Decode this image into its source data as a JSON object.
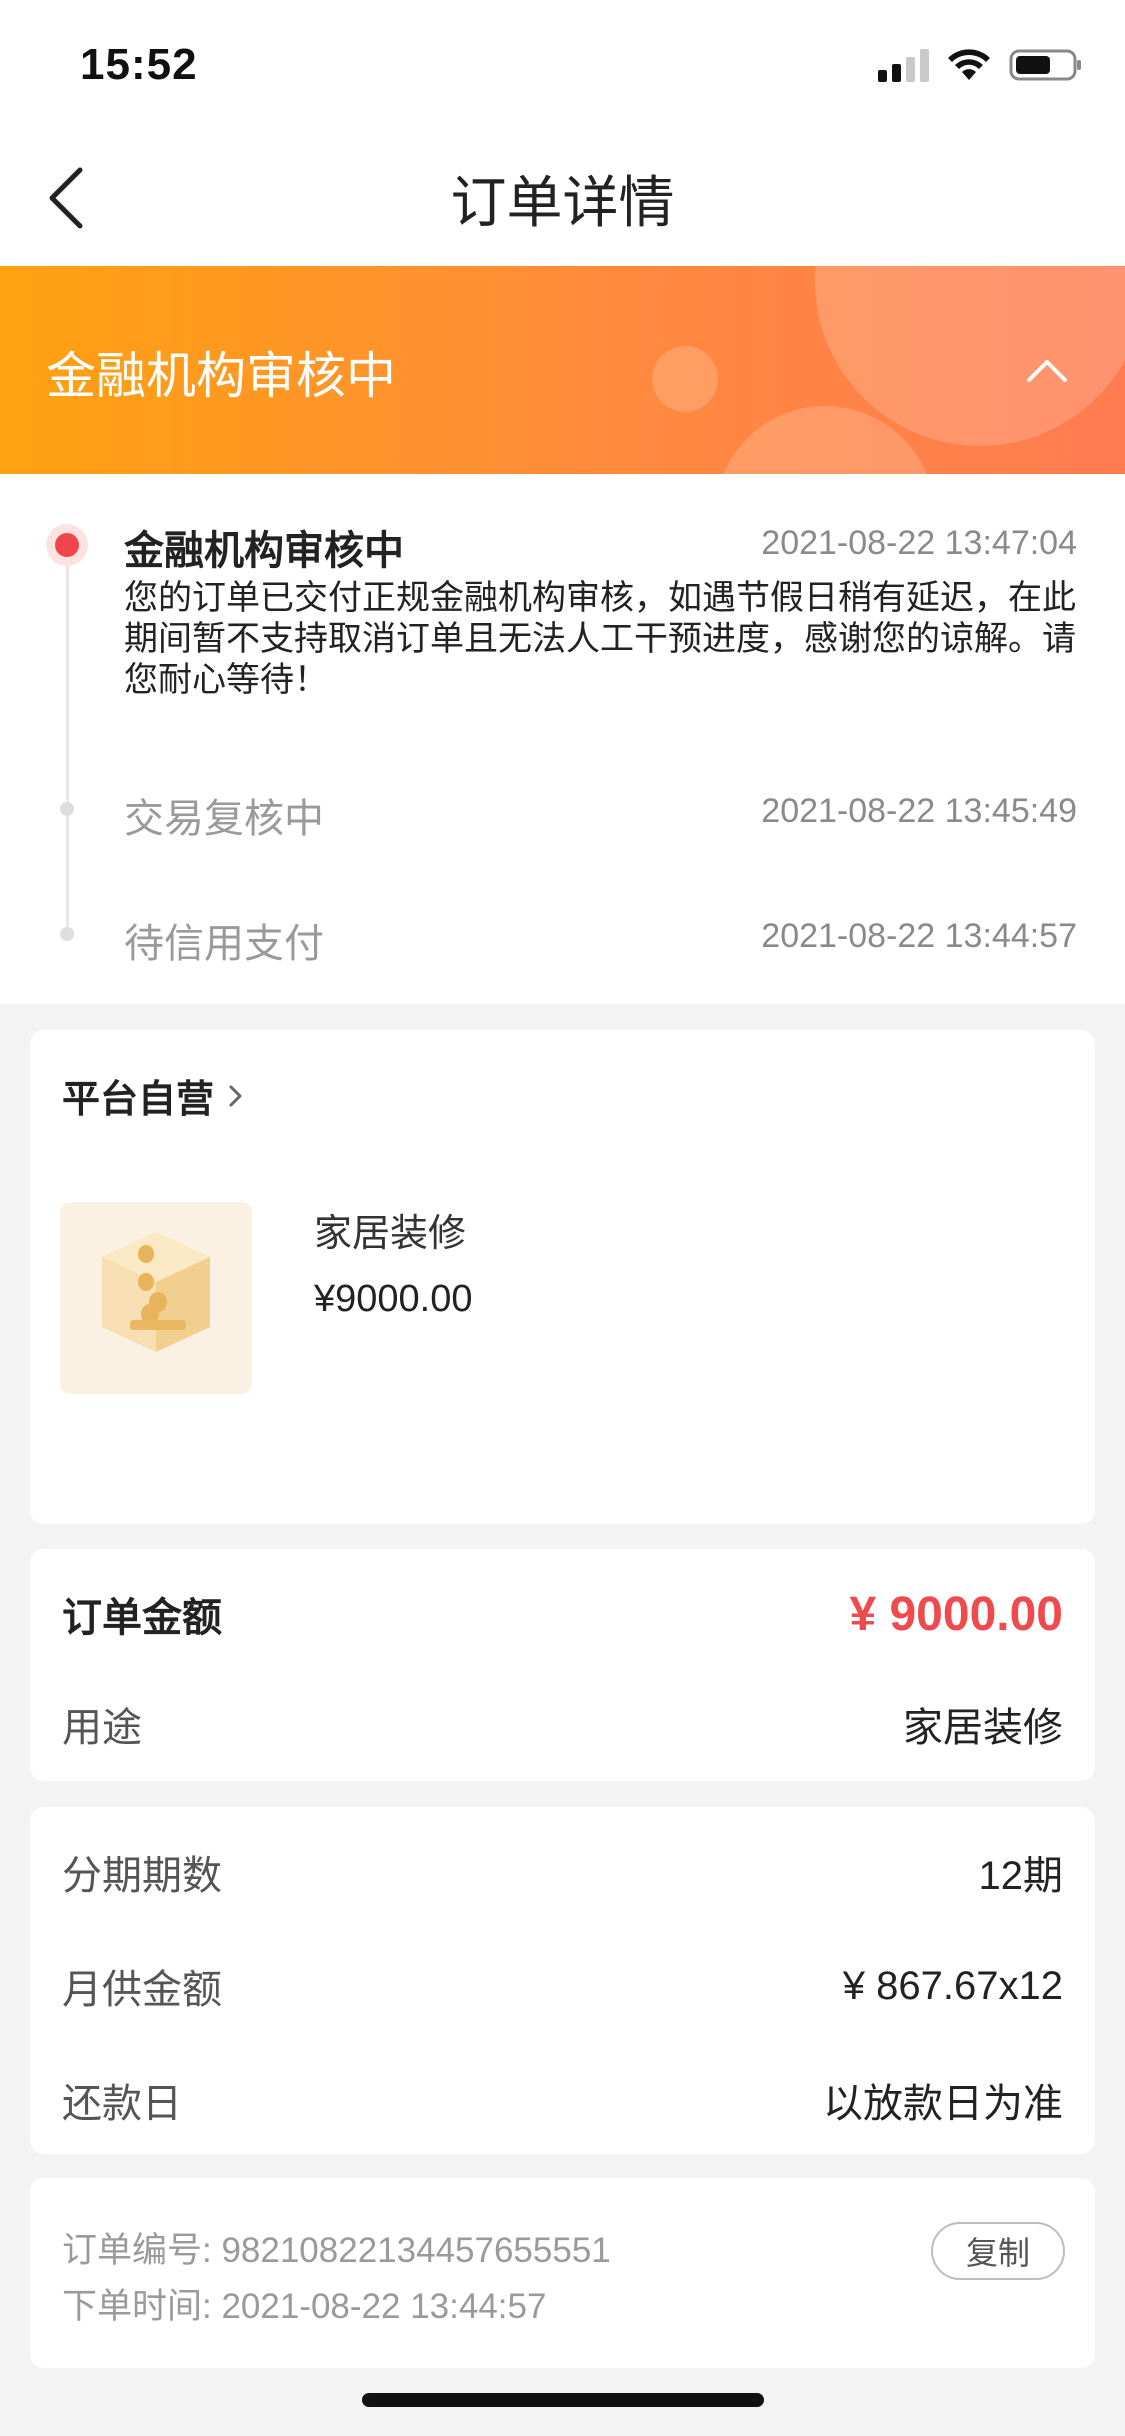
{
  "status_bar": {
    "time": "15:52"
  },
  "nav": {
    "title": "订单详情"
  },
  "banner": {
    "title": "金融机构审核中"
  },
  "timeline": [
    {
      "title": "金融机构审核中",
      "time": "2021-08-22 13:47:04",
      "desc": "您的订单已交付正规金融机构审核，如遇节假日稍有延迟，在此期间暂不支持取消订单且无法人工干预进度，感谢您的谅解。请您耐心等待！"
    },
    {
      "title": "交易复核中",
      "time": "2021-08-22 13:45:49"
    },
    {
      "title": "待信用支付",
      "time": "2021-08-22 13:44:57"
    }
  ],
  "shop": {
    "name": "平台自营"
  },
  "product": {
    "name": "家居装修",
    "price": "¥9000.00"
  },
  "amount": {
    "label": "订单金额",
    "value": "¥ 9000.00",
    "usage_label": "用途",
    "usage_value": "家居装修"
  },
  "installment": {
    "periods_label": "分期期数",
    "periods_value": "12期",
    "monthly_label": "月供金额",
    "monthly_value": "¥ 867.67x12",
    "repay_label": "还款日",
    "repay_value": "以放款日为准"
  },
  "order_meta": {
    "order_no": "订单编号: 98210822134457655551",
    "order_time": "下单时间: 2021-08-22 13:44:57",
    "copy_label": "复制"
  },
  "colors": {
    "accent_red": "#ef4b4f",
    "banner_start": "#ffa20f",
    "banner_end": "#ff7b52"
  }
}
